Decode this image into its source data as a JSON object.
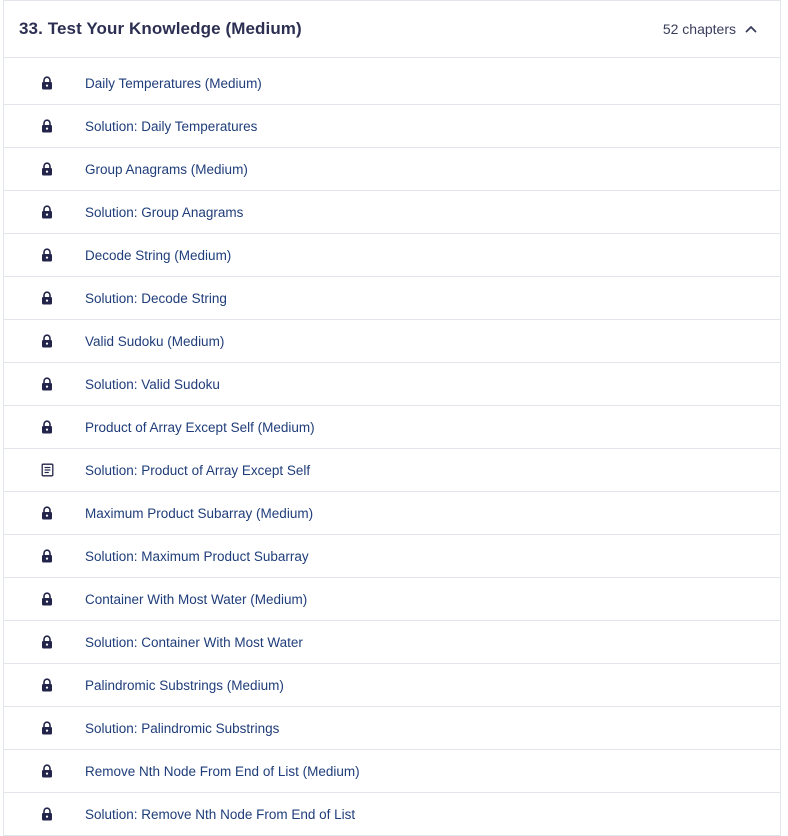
{
  "section": {
    "title": "33.  Test Your Knowledge (Medium)",
    "chapter_count": "52 chapters",
    "expanded": true
  },
  "colors": {
    "title": "#2c2f52",
    "link": "#1f3d7a",
    "icon": "#22244a",
    "divider": "#e3e5ec"
  },
  "chapters": [
    {
      "label": "Daily Temperatures (Medium)",
      "icon": "lock-icon"
    },
    {
      "label": "Solution: Daily Temperatures",
      "icon": "lock-icon"
    },
    {
      "label": "Group Anagrams (Medium)",
      "icon": "lock-icon"
    },
    {
      "label": "Solution: Group Anagrams",
      "icon": "lock-icon"
    },
    {
      "label": "Decode String (Medium)",
      "icon": "lock-icon"
    },
    {
      "label": "Solution: Decode String",
      "icon": "lock-icon"
    },
    {
      "label": "Valid Sudoku (Medium)",
      "icon": "lock-icon"
    },
    {
      "label": "Solution: Valid Sudoku",
      "icon": "lock-icon"
    },
    {
      "label": "Product of Array Except Self (Medium)",
      "icon": "lock-icon"
    },
    {
      "label": "Solution: Product of Array Except Self",
      "icon": "document-icon"
    },
    {
      "label": "Maximum Product Subarray (Medium)",
      "icon": "lock-icon"
    },
    {
      "label": "Solution: Maximum Product Subarray",
      "icon": "lock-icon"
    },
    {
      "label": "Container With Most Water (Medium)",
      "icon": "lock-icon"
    },
    {
      "label": "Solution: Container With Most Water",
      "icon": "lock-icon"
    },
    {
      "label": "Palindromic Substrings (Medium)",
      "icon": "lock-icon"
    },
    {
      "label": "Solution: Palindromic Substrings",
      "icon": "lock-icon"
    },
    {
      "label": "Remove Nth Node From End of List (Medium)",
      "icon": "lock-icon"
    },
    {
      "label": "Solution: Remove Nth Node From End of List",
      "icon": "lock-icon"
    }
  ]
}
